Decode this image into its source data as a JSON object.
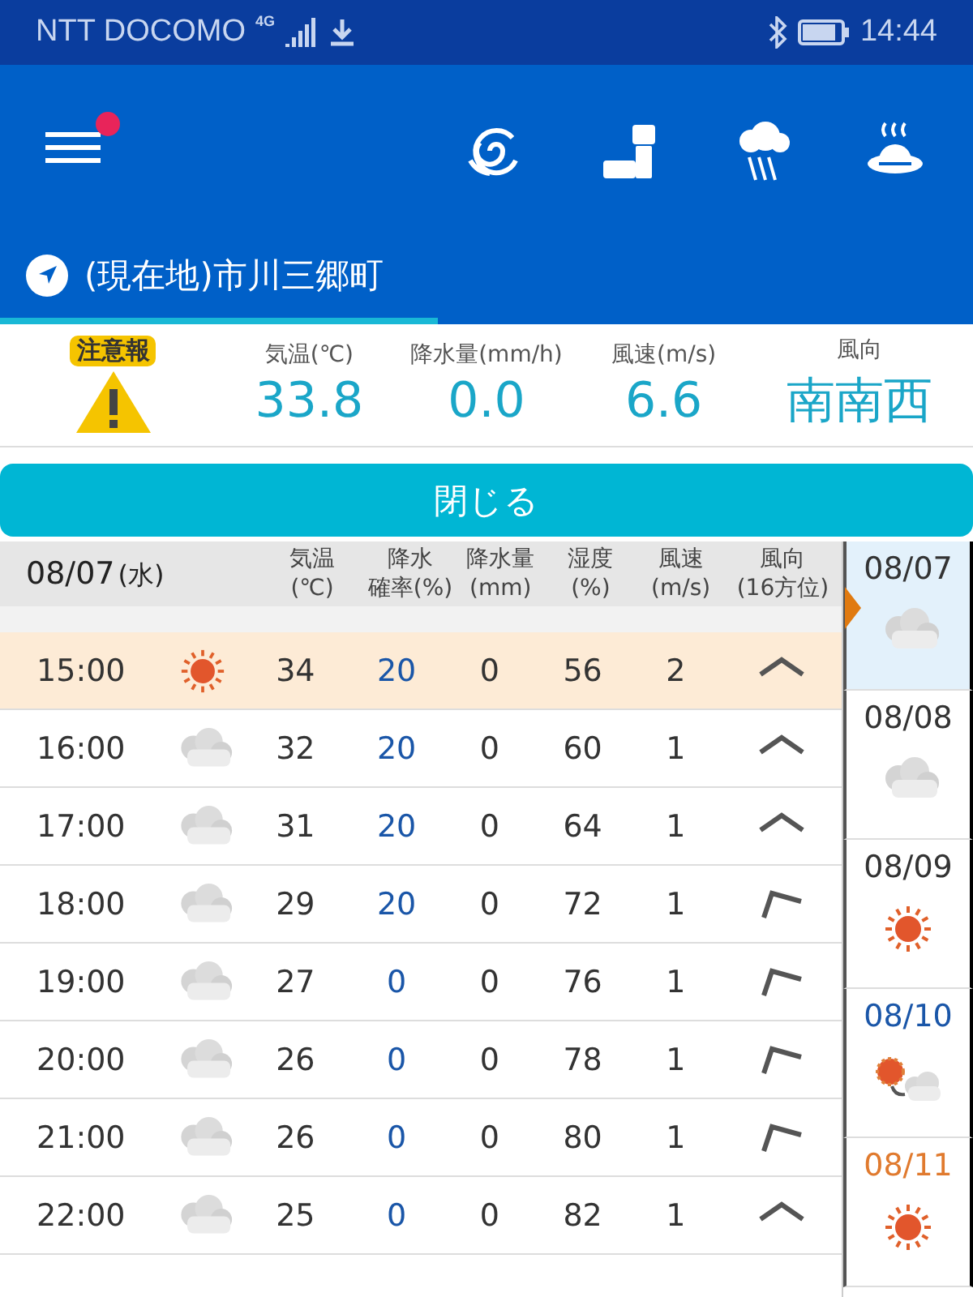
{
  "status_bar": {
    "carrier": "NTT DOCOMO",
    "network": "4G",
    "time": "14:44"
  },
  "app_bar": {
    "menu_badge": true
  },
  "location_tab": {
    "label": "(現在地)市川三郷町",
    "selected": true
  },
  "current": {
    "warning": "注意報",
    "columns": [
      {
        "label": "気温(℃)",
        "value": "33.8"
      },
      {
        "label": "降水量(mm/h)",
        "value": "0.0"
      },
      {
        "label": "風速(m/s)",
        "value": "6.6"
      },
      {
        "label": "風向",
        "value": "南南西"
      }
    ]
  },
  "close_button": "閉じる",
  "table": {
    "date": "08/07",
    "weekday": "(水)",
    "columns": [
      {
        "line1": "気温",
        "line2": "(℃)"
      },
      {
        "line1": "降水",
        "line2": "確率(%)"
      },
      {
        "line1": "降水量",
        "line2": "(mm)"
      },
      {
        "line1": "湿度",
        "line2": "(%)"
      },
      {
        "line1": "風速",
        "line2": "(m/s)"
      },
      {
        "line1": "風向",
        "line2": "(16方位)"
      }
    ],
    "rows": [
      {
        "time": "15:00",
        "weather": {
          "kind": "sunny"
        },
        "temp": "34",
        "prob": "20",
        "amount": "0",
        "humidity": "56",
        "wind": "2",
        "direction": {
          "kind": "north"
        },
        "selected": true
      },
      {
        "time": "16:00",
        "weather": {
          "kind": "cloudy"
        },
        "temp": "32",
        "prob": "20",
        "amount": "0",
        "humidity": "60",
        "wind": "1",
        "direction": {
          "kind": "north"
        },
        "selected": false
      },
      {
        "time": "17:00",
        "weather": {
          "kind": "cloudy"
        },
        "temp": "31",
        "prob": "20",
        "amount": "0",
        "humidity": "64",
        "wind": "1",
        "direction": {
          "kind": "north"
        },
        "selected": false
      },
      {
        "time": "18:00",
        "weather": {
          "kind": "cloudy"
        },
        "temp": "29",
        "prob": "20",
        "amount": "0",
        "humidity": "72",
        "wind": "1",
        "direction": {
          "kind": "nne"
        },
        "selected": false
      },
      {
        "time": "19:00",
        "weather": {
          "kind": "cloudy"
        },
        "temp": "27",
        "prob": "0",
        "amount": "0",
        "humidity": "76",
        "wind": "1",
        "direction": {
          "kind": "nne"
        },
        "selected": false
      },
      {
        "time": "20:00",
        "weather": {
          "kind": "cloudy"
        },
        "temp": "26",
        "prob": "0",
        "amount": "0",
        "humidity": "78",
        "wind": "1",
        "direction": {
          "kind": "nne"
        },
        "selected": false
      },
      {
        "time": "21:00",
        "weather": {
          "kind": "cloudy"
        },
        "temp": "26",
        "prob": "0",
        "amount": "0",
        "humidity": "80",
        "wind": "1",
        "direction": {
          "kind": "nne"
        },
        "selected": false
      },
      {
        "time": "22:00",
        "weather": {
          "kind": "cloudy"
        },
        "temp": "25",
        "prob": "0",
        "amount": "0",
        "humidity": "82",
        "wind": "1",
        "direction": {
          "kind": "north"
        },
        "selected": false
      }
    ]
  },
  "days": [
    {
      "date": "08/07",
      "weather": {
        "kind": "cloudy"
      },
      "color": "#333333",
      "selected": true
    },
    {
      "date": "08/08",
      "weather": {
        "kind": "cloudy"
      },
      "color": "#333333",
      "selected": false
    },
    {
      "date": "08/09",
      "weather": {
        "kind": "sunny"
      },
      "color": "#333333",
      "selected": false
    },
    {
      "date": "08/10",
      "weather": {
        "kind": "mixed"
      },
      "color": "#1a56a8",
      "selected": false
    },
    {
      "date": "08/11",
      "weather": {
        "kind": "sunny"
      },
      "color": "#e07a2e",
      "selected": false
    }
  ]
}
